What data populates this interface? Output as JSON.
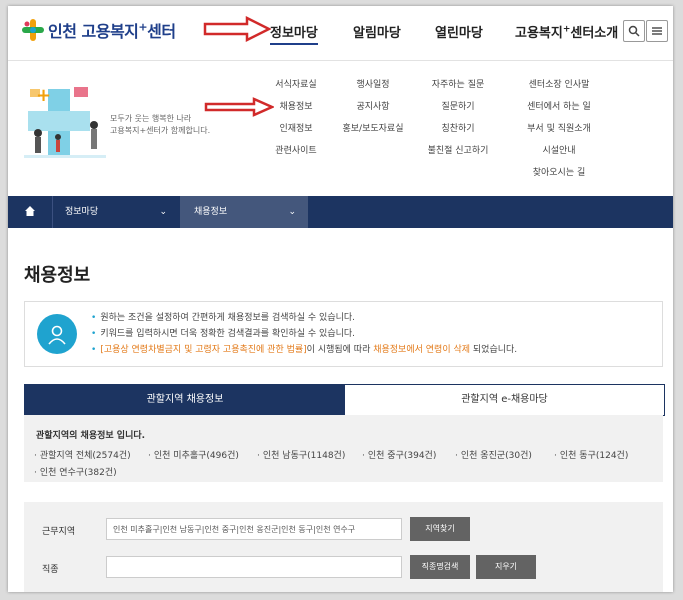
{
  "header": {
    "logo_text": "인천 고용복지",
    "logo_sup": "+",
    "logo_suffix": "센터",
    "nav": [
      "정보마당",
      "알림마당",
      "열린마당"
    ],
    "nav_last": "고용복지",
    "nav_last_sup": "+",
    "nav_last_suffix": "센터소개",
    "active_index": 0,
    "search_icon": "search-icon",
    "menu_icon": "hamburger-icon"
  },
  "mega_menu": {
    "slogan_line1": "모두가 웃는 행복한 나라",
    "slogan_line2": "고용복지+센터가 함께합니다.",
    "columns": [
      [
        "서식자료실",
        "채용정보",
        "인재정보",
        "관련사이트"
      ],
      [
        "행사일정",
        "공지사항",
        "홍보/보도자료실"
      ],
      [
        "자주하는 질문",
        "질문하기",
        "칭찬하기",
        "불친절 신고하기"
      ],
      [
        "센터소장 인사말",
        "센터에서 하는 일",
        "부서 및 직원소개",
        "시설안내",
        "찾아오시는 길"
      ]
    ]
  },
  "breadcrumb": {
    "home_icon": "home-icon",
    "level1": "정보마당",
    "level2": "채용정보"
  },
  "page": {
    "title": "채용정보"
  },
  "info": {
    "line1": "원하는 조건을 설정하여 간편하게 채용정보를 검색하실 수 있습니다.",
    "line2": "키워드를 입력하시면 더욱 정확한 검색결과를 확인하실 수 있습니다.",
    "line3_hl1": "[고용상 연령차별금지 및 고령자 고용촉진에 관한 법률]",
    "line3_mid": "이 시행됨에 따라 ",
    "line3_hl2": "채용정보에서 연령이 삭제",
    "line3_end": " 되었습니다."
  },
  "tabs": [
    "관할지역 채용정보",
    "관할지역 e-채용마당"
  ],
  "region": {
    "title": "관할지역의 채용정보 입니다.",
    "items": [
      "관할지역 전체(2574건)",
      "인천 미추홀구(496건)",
      "인천 남동구(1148건)",
      "인천 중구(394건)",
      "인천 옹진군(30건)",
      "인천 동구(124건)",
      "인천 연수구(382건)"
    ]
  },
  "search": {
    "work_area_label": "근무지역",
    "work_area_value": "인천 미추홀구|인천 남동구|인천 중구|인천 옹진군|인천 동구|인천 연수구",
    "work_area_btn": "지역찾기",
    "job_label": "직종",
    "job_value": "",
    "job_search_btn": "직종명검색",
    "clear_btn": "지우기"
  },
  "colors": {
    "brand": "#1f3f8a",
    "navy": "#1c3461",
    "accent": "#1fa3cf",
    "highlight": "#e37b1b",
    "annotation_arrow": "#d12a2a"
  }
}
